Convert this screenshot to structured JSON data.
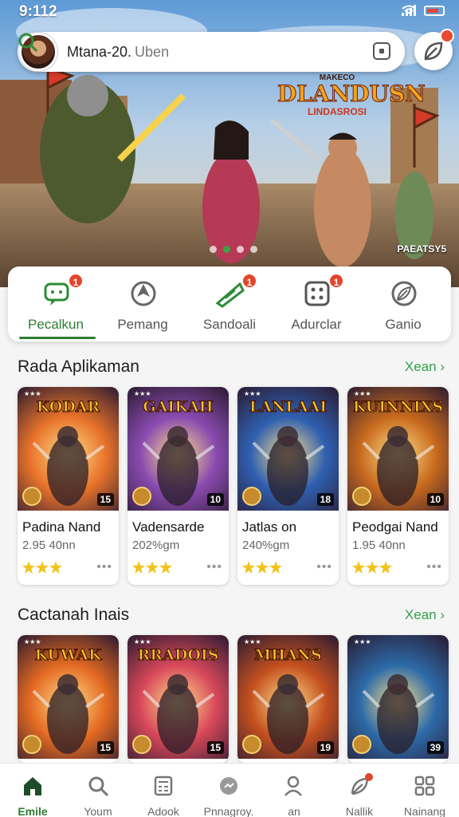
{
  "status": {
    "time": "9:112"
  },
  "search": {
    "user": "Mtana-20.",
    "placeholder": "Uben"
  },
  "hero": {
    "logo_top": "MAKECO",
    "logo_title": "DLANDUSN",
    "logo_sub": "LINDASROSI",
    "tag": "PAEATSY5",
    "slide_index": 1,
    "slide_count": 4
  },
  "categories": [
    {
      "label": "Pecalkun",
      "icon": "chat-bubble-icon",
      "badge": "1",
      "active": true
    },
    {
      "label": "Pemang",
      "icon": "compass-icon",
      "badge": "",
      "active": false
    },
    {
      "label": "Sandoali",
      "icon": "ticket-icon",
      "badge": "1",
      "active": false
    },
    {
      "label": "Adurclar",
      "icon": "dice-icon",
      "badge": "1",
      "active": false
    },
    {
      "label": "Ganio",
      "icon": "leaf-icon",
      "badge": "",
      "active": false
    }
  ],
  "section1": {
    "title": "Rada Aplikaman",
    "more": "Xean",
    "items": [
      {
        "thumb_title": "KODAR",
        "name": "Padina Nand",
        "size": "2.95 40nn",
        "num": "15",
        "stars": 3,
        "bg": "#e8732a"
      },
      {
        "thumb_title": "GAIKAH",
        "name": "Vadensarde",
        "size": "202%gm",
        "num": "10",
        "stars": 3,
        "bg": "#8a4bb0"
      },
      {
        "thumb_title": "LANLAAI",
        "name": "Jatlas on",
        "size": "240%gm",
        "num": "18",
        "stars": 3,
        "bg": "#2f5fb0"
      },
      {
        "thumb_title": "KUINNIXS",
        "name": "Peodgai Nand",
        "size": "1.95 40nn",
        "num": "10",
        "stars": 3,
        "bg": "#c86a1e"
      }
    ]
  },
  "section2": {
    "title": "Cactanah Inais",
    "more": "Xean",
    "items": [
      {
        "thumb_title": "KUWAK",
        "num": "15",
        "bg": "#e46a22"
      },
      {
        "thumb_title": "RRADOIS",
        "num": "15",
        "bg": "#d8485a"
      },
      {
        "thumb_title": "MHANS",
        "num": "19",
        "bg": "#c4501f"
      },
      {
        "thumb_title": "",
        "num": "39",
        "bg": "#2c6aa8"
      }
    ]
  },
  "nav": [
    {
      "label": "Emile",
      "icon": "home-icon",
      "active": true
    },
    {
      "label": "Youm",
      "icon": "search-icon",
      "active": false
    },
    {
      "label": "Adook",
      "icon": "calculator-icon",
      "active": false
    },
    {
      "label": "Pnnagroy.",
      "icon": "chat-icon",
      "active": false
    },
    {
      "label": "an",
      "icon": "person-icon",
      "active": false
    },
    {
      "label": "Nallik",
      "icon": "leaf-icon",
      "active": false
    },
    {
      "label": "Nainang",
      "icon": "grid-icon",
      "active": false
    }
  ],
  "colors": {
    "accent": "#2e7d32",
    "badge": "#e2452b",
    "more_link": "#34a04a"
  }
}
